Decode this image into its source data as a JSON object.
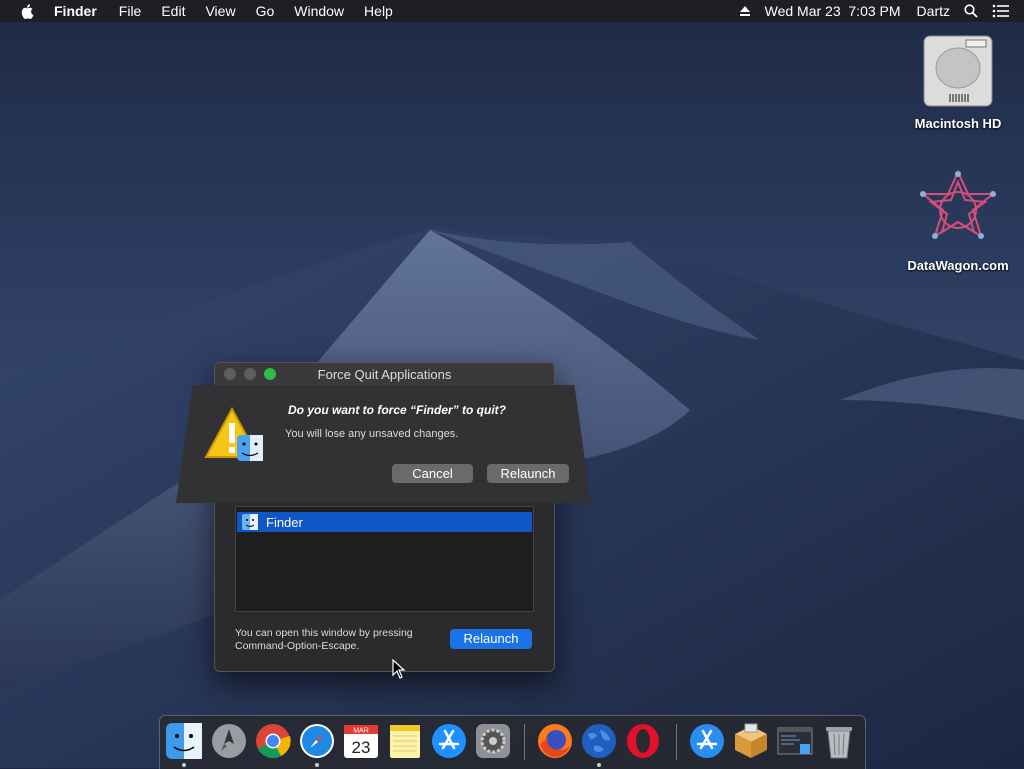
{
  "menubar": {
    "app_name": "Finder",
    "items": [
      "File",
      "Edit",
      "View",
      "Go",
      "Window",
      "Help"
    ],
    "clock": "Wed Mar 23  7:03 PM",
    "user": "Dartz"
  },
  "desktop": {
    "icons": [
      {
        "label": "Macintosh HD",
        "icon": "hard-drive-icon"
      },
      {
        "label": "DataWagon.com",
        "icon": "datawagon-icon"
      }
    ]
  },
  "force_quit": {
    "window_title": "Force Quit Applications",
    "selected_app": "Finder",
    "hint_line1": "You can open this window by pressing",
    "hint_line2": "Command-Option-Escape.",
    "relaunch_label": "Relaunch"
  },
  "sheet": {
    "title": "Do you want to force “Finder” to quit?",
    "message": "You will lose any unsaved changes.",
    "cancel_label": "Cancel",
    "relaunch_label": "Relaunch"
  },
  "dock": {
    "calendar_month": "MAR",
    "calendar_day": "23",
    "apps": [
      "finder-icon",
      "launchpad-icon",
      "chrome-icon",
      "safari-icon",
      "calendar-icon",
      "notes-icon",
      "app-store-icon",
      "system-preferences-icon",
      "firefox-icon",
      "network-globe-icon",
      "opera-icon",
      "app-store-downloads-icon",
      "package-installer-icon",
      "screenshot-viewer-icon",
      "trash-icon"
    ]
  },
  "colors": {
    "accent": "#1a74e8",
    "selection": "#0f56c7",
    "zoom_button": "#2fbd4a"
  }
}
